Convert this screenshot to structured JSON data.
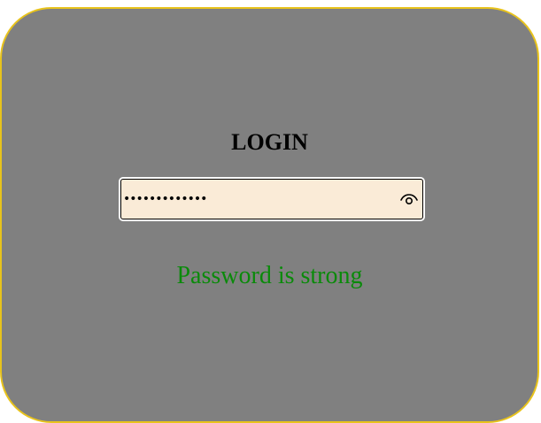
{
  "form": {
    "title": "LOGIN",
    "password_value": "•••••••••••••",
    "toggle_icon": "eye-icon",
    "status_text": "Password is strong"
  },
  "colors": {
    "card_background": "#808080",
    "card_border": "#e8c31c",
    "input_background": "#faebd7",
    "status_color": "#0a8a0a"
  }
}
